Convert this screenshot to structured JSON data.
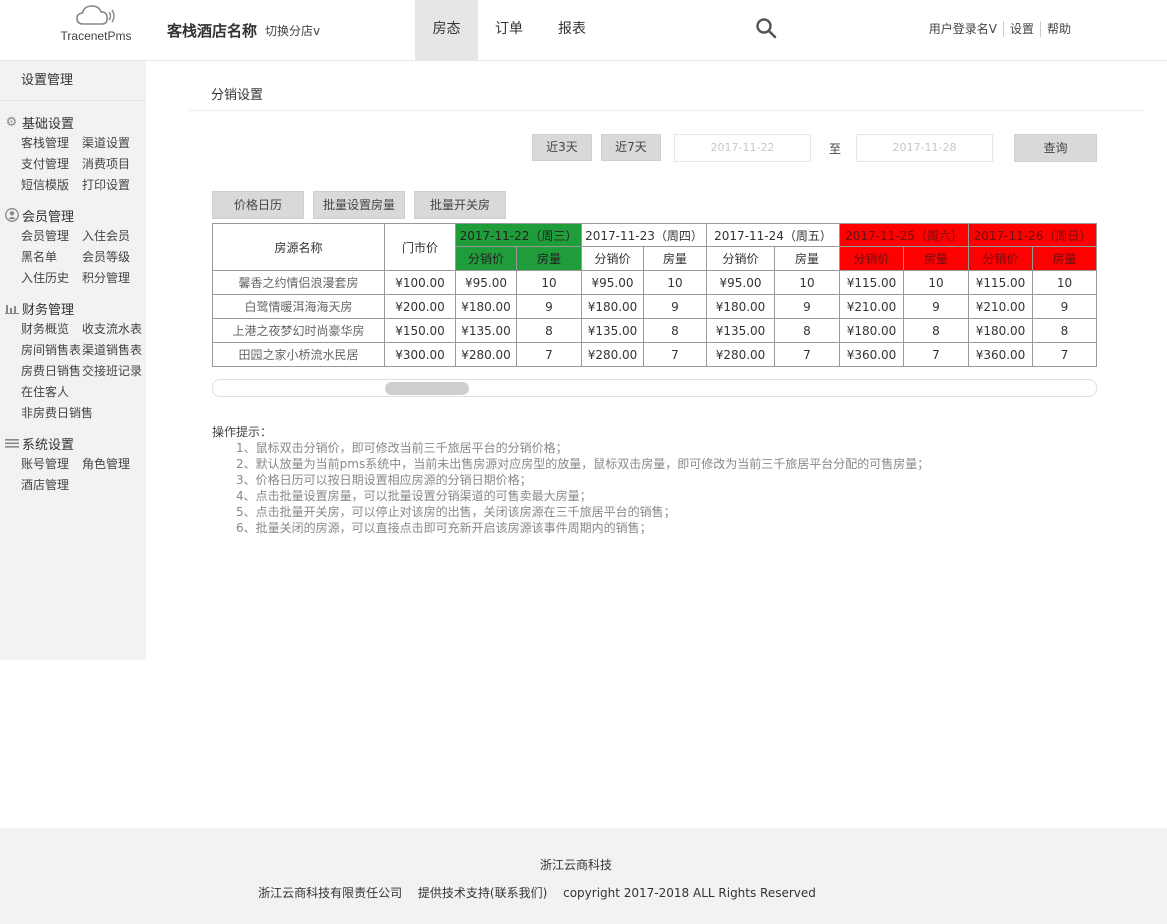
{
  "header": {
    "logo_text": "TracenetPms",
    "hotel_name": "客栈酒店名称",
    "switch_store": "切换分店v",
    "nav": [
      "房态",
      "订单",
      "报表"
    ],
    "user_links": [
      "用户登录名V",
      "设置",
      "帮助"
    ]
  },
  "sidebar": {
    "title": "设置管理",
    "groups": [
      {
        "title": "基础设置",
        "icon": "gear-icon",
        "links": [
          "客栈管理",
          "渠道设置",
          "支付管理",
          "消费项目",
          "短信模版",
          "打印设置"
        ]
      },
      {
        "title": "会员管理",
        "icon": "user-icon",
        "links": [
          "会员管理",
          "入住会员",
          "黑名单",
          "会员等级",
          "入住历史",
          "积分管理"
        ]
      },
      {
        "title": "财务管理",
        "icon": "bar-chart-icon",
        "links": [
          "财务概览",
          "收支流水表",
          "房间销售表",
          "渠道销售表",
          "房费日销售",
          "交接班记录",
          "在住客人",
          "非房费日销售"
        ]
      },
      {
        "title": "系统设置",
        "icon": "menu-icon",
        "links": [
          "账号管理",
          "角色管理",
          "酒店管理"
        ]
      }
    ]
  },
  "main": {
    "page_title": "分销设置",
    "btn_3days": "近3天",
    "btn_7days": "近7天",
    "date_from": "2017-11-22",
    "date_to": "2017-11-28",
    "to_label": "至",
    "query": "查询",
    "actions": [
      "价格日历",
      "批量设置房量",
      "批量开关房"
    ],
    "table": {
      "col_room": "房源名称",
      "col_price": "门市价",
      "sub_price": "分销价",
      "sub_qty": "房量",
      "dates": [
        {
          "label": "2017-11-22（周三）",
          "color": "#1f9d3a"
        },
        {
          "label": "2017-11-23（周四）",
          "color": ""
        },
        {
          "label": "2017-11-24（周五）",
          "color": ""
        },
        {
          "label": "2017-11-25（周六）",
          "color": "#ff0000"
        },
        {
          "label": "2017-11-26（周日）",
          "color": "#ff0000"
        }
      ],
      "rows": [
        {
          "name": "馨香之约情侣浪漫套房",
          "price": "¥100.00",
          "cells": [
            [
              "¥95.00",
              "10"
            ],
            [
              "¥95.00",
              "10"
            ],
            [
              "¥95.00",
              "10"
            ],
            [
              "¥115.00",
              "10"
            ],
            [
              "¥115.00",
              "10"
            ]
          ]
        },
        {
          "name": "白鹭情暖洱海海天房",
          "price": "¥200.00",
          "cells": [
            [
              "¥180.00",
              "9"
            ],
            [
              "¥180.00",
              "9"
            ],
            [
              "¥180.00",
              "9"
            ],
            [
              "¥210.00",
              "9"
            ],
            [
              "¥210.00",
              "9"
            ]
          ]
        },
        {
          "name": "上港之夜梦幻时尚豪华房",
          "price": "¥150.00",
          "cells": [
            [
              "¥135.00",
              "8"
            ],
            [
              "¥135.00",
              "8"
            ],
            [
              "¥135.00",
              "8"
            ],
            [
              "¥180.00",
              "8"
            ],
            [
              "¥180.00",
              "8"
            ]
          ]
        },
        {
          "name": "田园之家小桥流水民居",
          "price": "¥300.00",
          "cells": [
            [
              "¥280.00",
              "7"
            ],
            [
              "¥280.00",
              "7"
            ],
            [
              "¥280.00",
              "7"
            ],
            [
              "¥360.00",
              "7"
            ],
            [
              "¥360.00",
              "7"
            ]
          ]
        }
      ]
    },
    "tips_title": "操作提示：",
    "tips": [
      "1、鼠标双击分销价，即可修改当前三千旅居平台的分销价格；",
      "2、默认放量为当前pms系统中，当前未出售房源对应房型的放量，鼠标双击房量，即可修改为当前三千旅居平台分配的可售房量；",
      "3、价格日历可以按日期设置相应房源的分销日期价格；",
      "4、点击批量设置房量，可以批量设置分销渠道的可售卖最大房量；",
      "5、点击批量开关房，可以停止对该房的出售，关闭该房源在三千旅居平台的销售；",
      "6、批量关闭的房源，可以直接点击即可充新开启该房源该事件周期内的销售；"
    ]
  },
  "footer": {
    "company": "浙江云商科技",
    "full_name": "浙江云商科技有限责任公司",
    "support": "提供技术支持(联系我们)",
    "copyright": "copyright 2017-2018 ALL Rights Reserved"
  }
}
